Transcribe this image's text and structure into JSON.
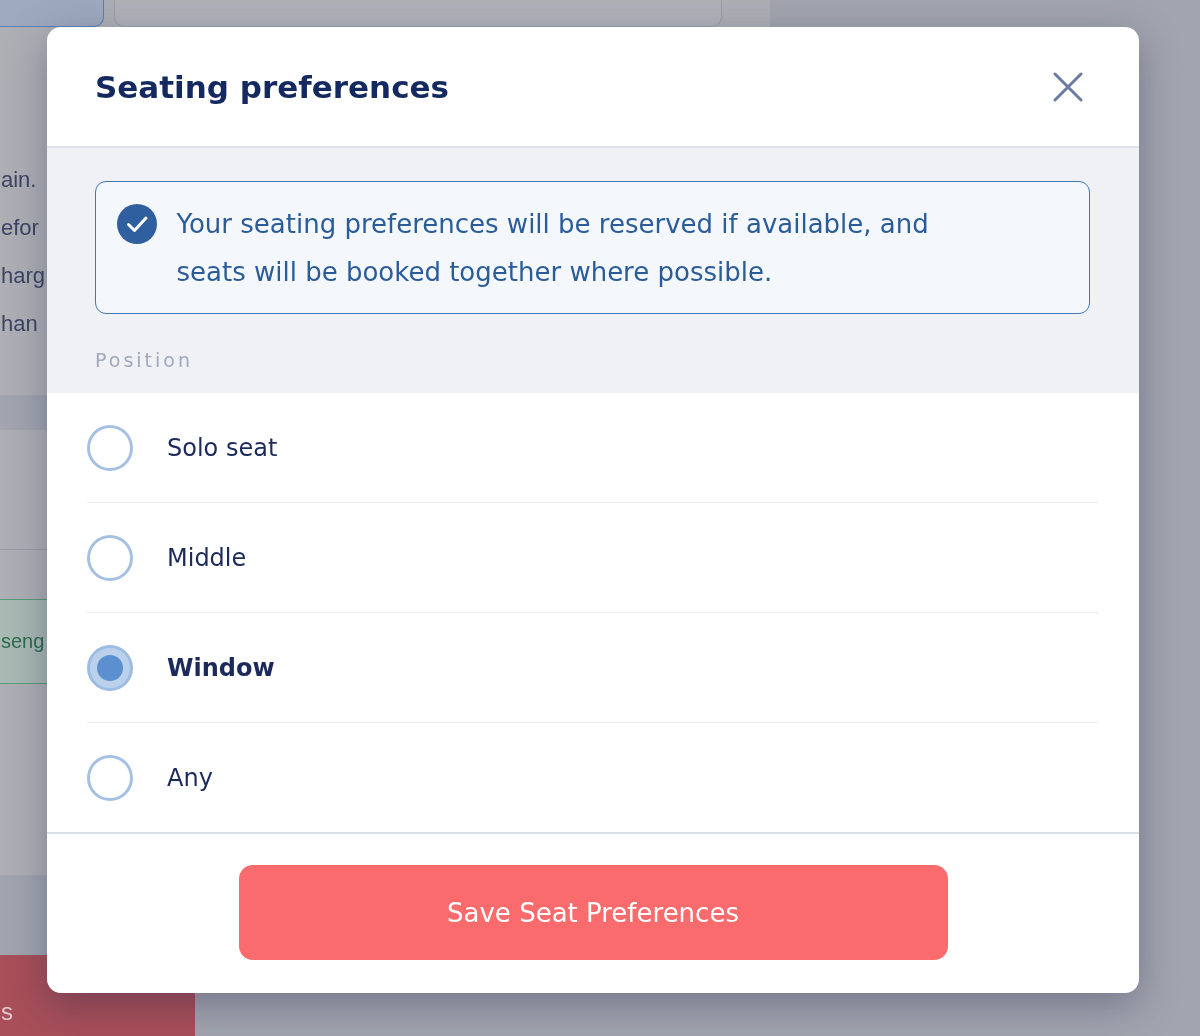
{
  "background_page": {
    "tiles": [
      {
        "selected": true
      },
      {
        "selected": false
      }
    ],
    "text_fragments": [
      "ain.",
      "efor",
      "harg",
      "han"
    ],
    "outlined_label": "seng",
    "button_label": "s"
  },
  "dialog": {
    "title": "Seating preferences",
    "info_banner": {
      "text": "Your seating preferences will be reserved if available, and seats will be booked together where possible."
    },
    "position": {
      "label": "Position",
      "options": [
        {
          "label": "Solo seat",
          "selected": false
        },
        {
          "label": "Middle",
          "selected": false
        },
        {
          "label": "Window",
          "selected": true
        },
        {
          "label": "Any",
          "selected": false
        }
      ]
    },
    "save_button": {
      "label": "Save Seat Preferences"
    }
  }
}
